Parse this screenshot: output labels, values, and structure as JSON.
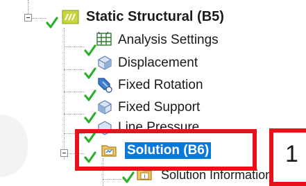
{
  "tree": {
    "root": {
      "label": "Static Structural (B5)"
    },
    "children": [
      {
        "label": "Analysis Settings",
        "icon": "analysis-settings-icon"
      },
      {
        "label": "Displacement",
        "icon": "displacement-icon"
      },
      {
        "label": "Fixed Rotation",
        "icon": "fixed-rotation-icon"
      },
      {
        "label": "Fixed Support",
        "icon": "fixed-support-icon"
      },
      {
        "label": "Line Pressure",
        "icon": "line-pressure-icon"
      }
    ],
    "solution": {
      "label": "Solution (B6)",
      "icon": "solution-folder-icon"
    },
    "solution_children": [
      {
        "label": "Solution Information",
        "icon": "solution-information-icon"
      }
    ]
  },
  "annotation": {
    "callout_number": "1"
  },
  "colors": {
    "highlight": "#e8121b",
    "selection": "#0a78d7",
    "check": "#2db02d"
  }
}
